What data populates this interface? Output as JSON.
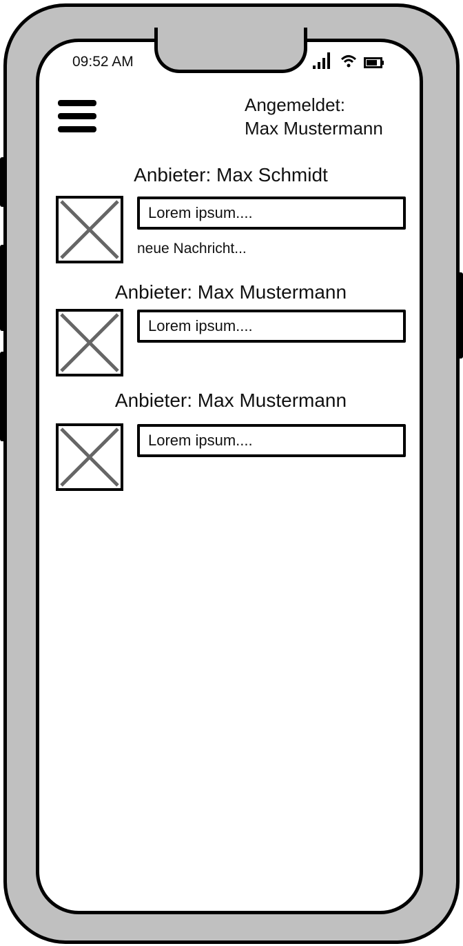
{
  "status_bar": {
    "time": "09:52 AM",
    "icons": [
      "signal-icon",
      "wifi-icon",
      "battery-icon"
    ]
  },
  "header": {
    "logged_in_label": "Angemeldet:",
    "user_name": "Max Mustermann"
  },
  "conversations": [
    {
      "title": "Anbieter: Max Schmidt",
      "preview": "Lorem ipsum....",
      "new_message": "neue Nachricht..."
    },
    {
      "title": "Anbieter: Max Mustermann",
      "preview": "Lorem ipsum...."
    },
    {
      "title": "Anbieter: Max Mustermann",
      "preview": "Lorem ipsum...."
    }
  ]
}
